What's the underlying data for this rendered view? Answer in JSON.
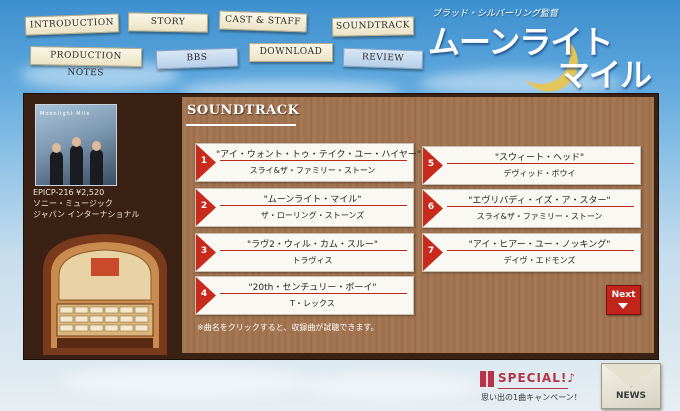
{
  "nav": [
    {
      "label": "INTRODUCTION",
      "variant": "cream"
    },
    {
      "label": "STORY",
      "variant": "cream"
    },
    {
      "label": "CAST & STAFF",
      "variant": "cream"
    },
    {
      "label": "SOUNDTRACK",
      "variant": "cream"
    },
    {
      "label": "PRODUCTION NOTES",
      "variant": "cream"
    },
    {
      "label": "BBS",
      "variant": "blue"
    },
    {
      "label": "DOWNLOAD",
      "variant": "cream"
    },
    {
      "label": "REVIEW",
      "variant": "blue"
    }
  ],
  "logo": {
    "director": "ブラッド・シルバーリング監督",
    "line1": "ムーンライト",
    "line2": "マイル"
  },
  "album": {
    "cover_title": "Moonlight Mile",
    "catalog": "EPICP-216 ¥2,520",
    "label_line1": "ソニー・ミュージック",
    "label_line2": "ジャパン インターナショナル"
  },
  "section": {
    "heading": "SOUNDTRACK"
  },
  "tracks": [
    {
      "num": "1",
      "title": "\"アイ・ウォント・トゥ・テイク・ユー・ハイヤー\"",
      "artist": "スライ&ザ・ファミリー・ストーン"
    },
    {
      "num": "2",
      "title": "\"ムーンライト・マイル\"",
      "artist": "ザ・ローリング・ストーンズ"
    },
    {
      "num": "3",
      "title": "\"ラヴ2・ウィル・カム・スルー\"",
      "artist": "トラヴィス"
    },
    {
      "num": "4",
      "title": "\"20th・センチュリー・ボーイ\"",
      "artist": "T・レックス"
    },
    {
      "num": "5",
      "title": "\"スウィート・ヘッド\"",
      "artist": "デヴィッド・ボウイ"
    },
    {
      "num": "6",
      "title": "\"エヴリバディ・イズ・ア・スター\"",
      "artist": "スライ&ザ・ファミリー・ストーン"
    },
    {
      "num": "7",
      "title": "\"アイ・ヒアー・ユー・ノッキング\"",
      "artist": "デイヴ・エドモンズ"
    }
  ],
  "note": "※曲名をクリックすると、収録曲が試聴できます。",
  "next_label": "Next",
  "special": {
    "label": "SPECIAL!♪",
    "sub": "思い出の1曲キャンペーン！"
  },
  "news_label": "NEWS",
  "colors": {
    "accent_red": "#c82a1c",
    "panel_brown": "#3b2014",
    "wood": "#a07351"
  }
}
